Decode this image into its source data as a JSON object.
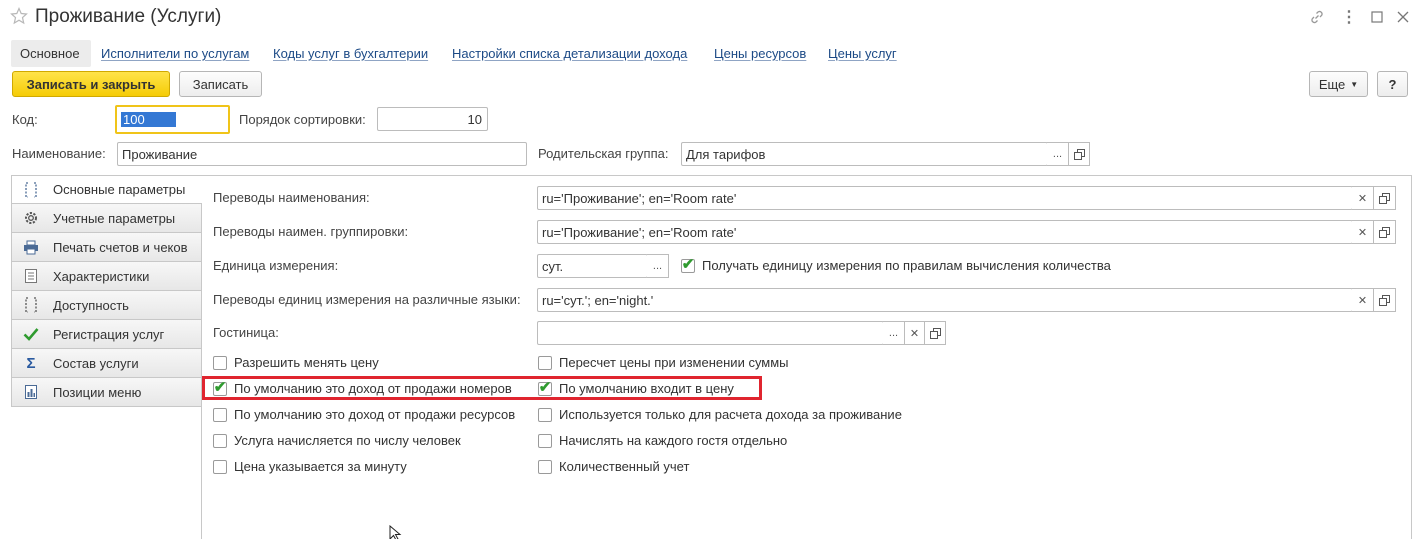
{
  "window": {
    "title": "Проживание (Услуги)"
  },
  "nav": {
    "tabs": [
      "Основное",
      "Исполнители по услугам",
      "Коды услуг в бухгалтерии",
      "Настройки списка детализации дохода",
      "Цены ресурсов",
      "Цены услуг"
    ]
  },
  "toolbar": {
    "save_close": "Записать и закрыть",
    "save": "Записать",
    "more": "Еще",
    "help": "?"
  },
  "header": {
    "code_label": "Код:",
    "code_value": "100",
    "sort_label": "Порядок сортировки:",
    "sort_value": "10",
    "name_label": "Наименование:",
    "name_value": "Проживание",
    "parent_label": "Родительская группа:",
    "parent_value": "Для тарифов"
  },
  "sidebar": {
    "items": [
      "Основные параметры",
      "Учетные параметры",
      "Печать счетов и чеков",
      "Характеристики",
      "Доступность",
      "Регистрация услуг",
      "Состав услуги",
      "Позиции меню"
    ]
  },
  "form": {
    "name_translations_label": "Переводы наименования:",
    "name_translations_value": "ru='Проживание'; en='Room rate'",
    "group_translations_label": "Переводы наимен. группировки:",
    "group_translations_value": "ru='Проживание'; en='Room rate'",
    "unit_label": "Единица измерения:",
    "unit_value": "сут.",
    "unit_checkbox_label": "Получать единицу измерения по правилам вычисления количества",
    "unit_translations_label": "Переводы единиц измерения на различные языки:",
    "unit_translations_value": "ru='сут.'; en='night.'",
    "hotel_label": "Гостиница:",
    "hotel_value": ""
  },
  "checkboxes": {
    "left": [
      {
        "label": "Разрешить менять цену",
        "checked": false
      },
      {
        "label": "По умолчанию это доход от продажи номеров",
        "checked": true
      },
      {
        "label": "По умолчанию это доход от продажи ресурсов",
        "checked": false
      },
      {
        "label": "Услуга начисляется по числу человек",
        "checked": false
      },
      {
        "label": "Цена указывается за минуту",
        "checked": false
      }
    ],
    "right": [
      {
        "label": "Пересчет цены при изменении суммы",
        "checked": false
      },
      {
        "label": "По умолчанию входит в цену",
        "checked": true
      },
      {
        "label": "Используется только для расчета дохода за проживание",
        "checked": false
      },
      {
        "label": "Начислять на каждого гостя отдельно",
        "checked": false
      },
      {
        "label": "Количественный учет",
        "checked": false
      }
    ]
  },
  "colors": {
    "highlight": "#e0252f",
    "primary": "#f5cc06",
    "link": "#1c4a86"
  }
}
